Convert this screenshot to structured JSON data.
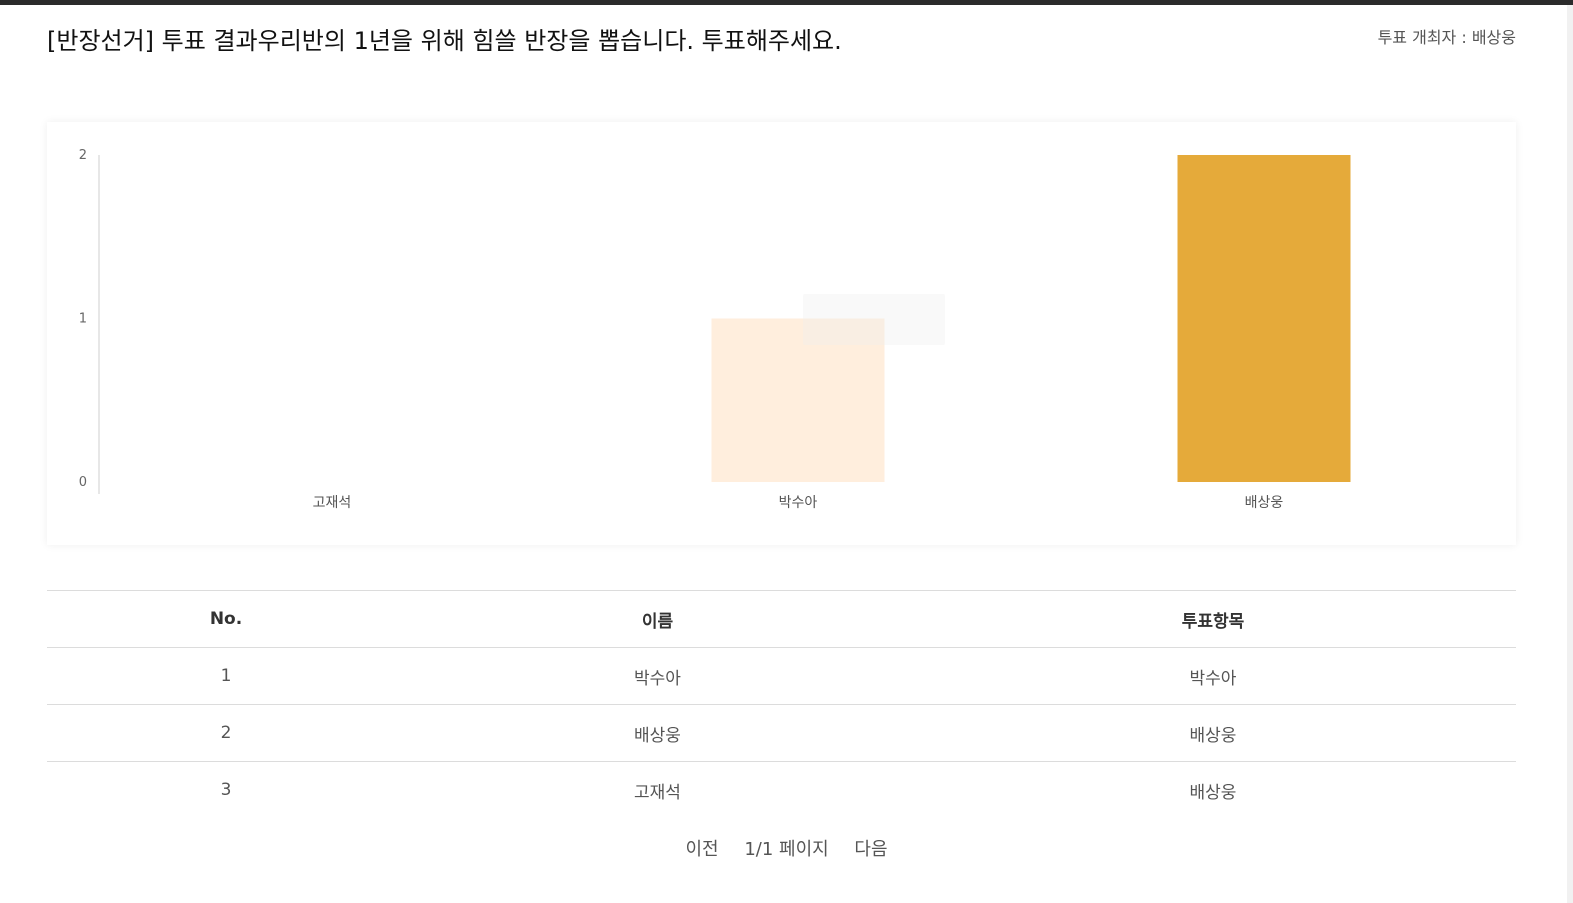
{
  "header": {
    "title": "[반장선거] 투표 결과우리반의 1년을 위해 힘쓸 반장을 뽑습니다. 투표해주세요.",
    "host": "투표 개최자 : 배상웅"
  },
  "chart_data": {
    "type": "bar",
    "categories": [
      "고재석",
      "박수아",
      "배상웅"
    ],
    "values": [
      0,
      1,
      2
    ],
    "colors": [
      "#ffeedd",
      "#ffeedd",
      "#e5aa3a"
    ],
    "yticks": [
      "0",
      "1",
      "2"
    ],
    "ylim": [
      0,
      2
    ],
    "grid": false
  },
  "table": {
    "headers": [
      "No.",
      "이름",
      "투표항목"
    ],
    "rows": [
      [
        "1",
        "박수아",
        "박수아"
      ],
      [
        "2",
        "배상웅",
        "배상웅"
      ],
      [
        "3",
        "고재석",
        "배상웅"
      ]
    ]
  },
  "pagination": {
    "prev": "이전",
    "page": "1/1 페이지",
    "next": "다음"
  }
}
